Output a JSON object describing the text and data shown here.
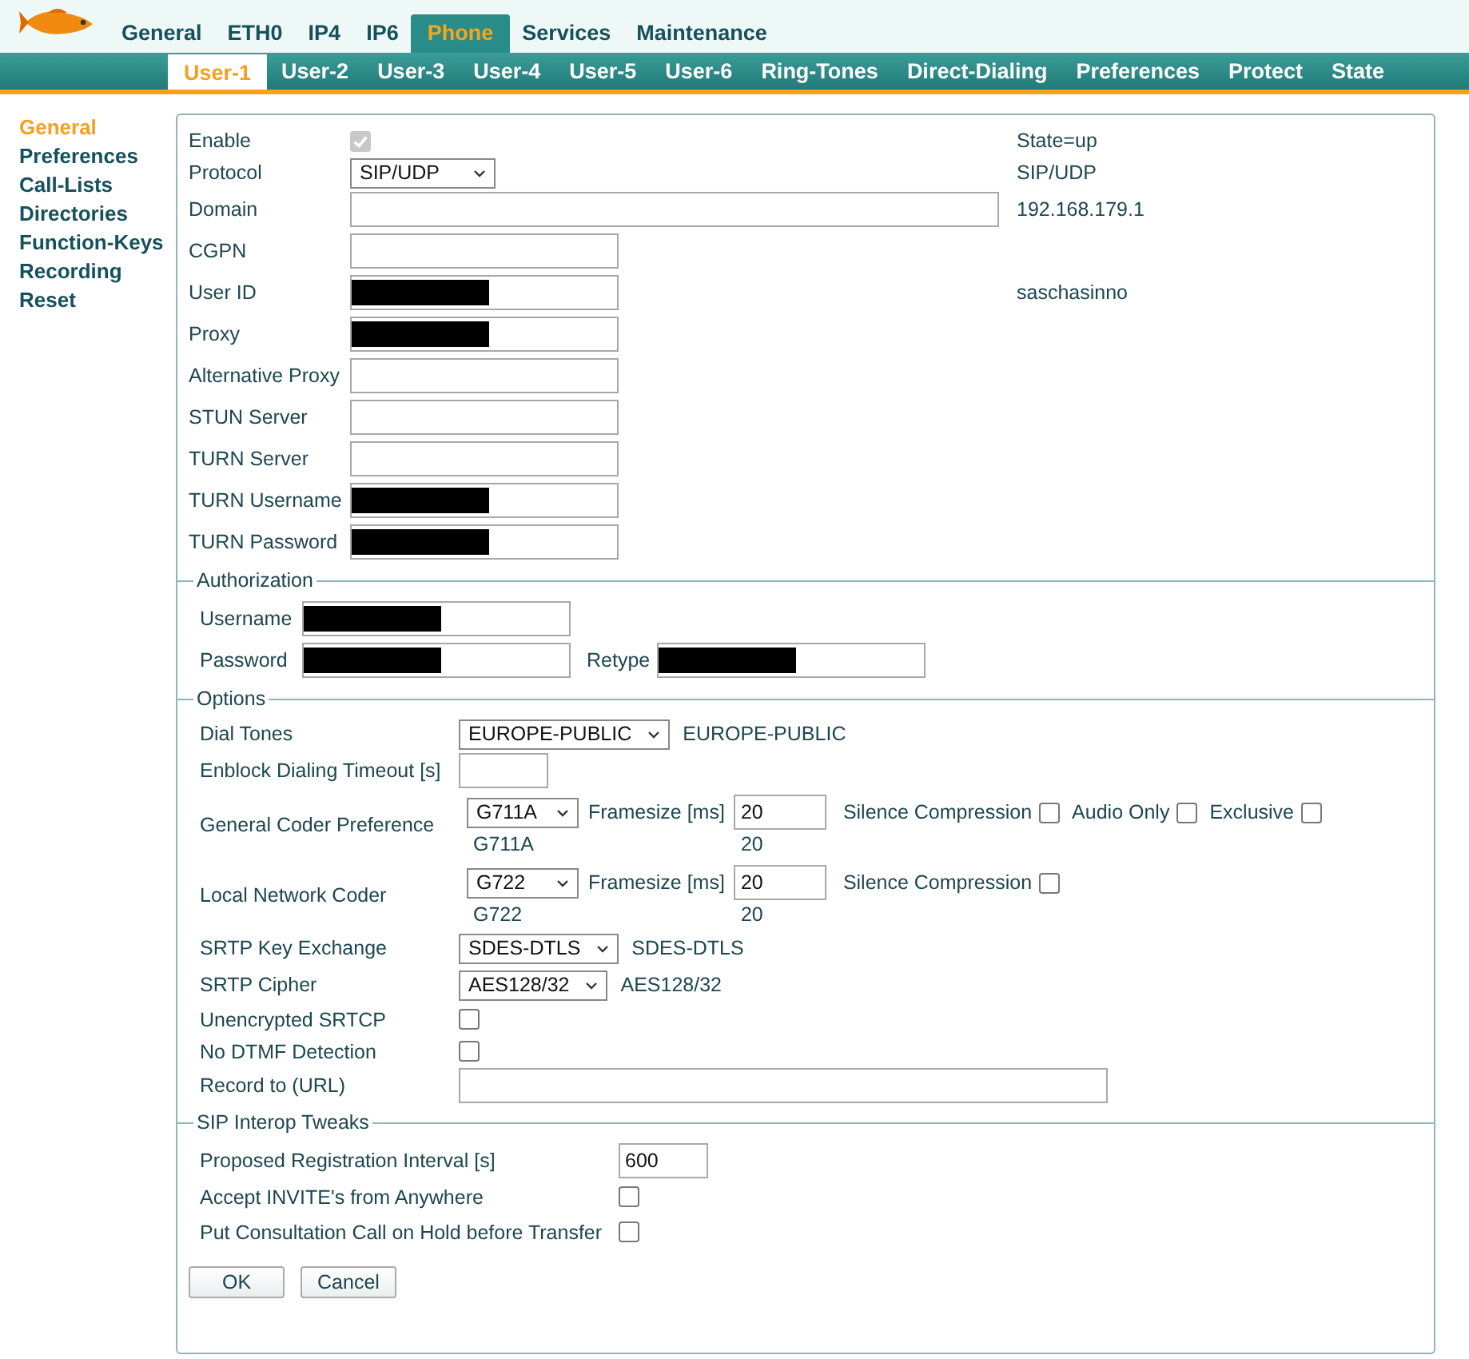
{
  "main_tabs": [
    {
      "label": "General",
      "selected": false
    },
    {
      "label": "ETH0",
      "selected": false
    },
    {
      "label": "IP4",
      "selected": false
    },
    {
      "label": "IP6",
      "selected": false
    },
    {
      "label": "Phone",
      "selected": true
    },
    {
      "label": "Services",
      "selected": false
    },
    {
      "label": "Maintenance",
      "selected": false
    }
  ],
  "sub_tabs": [
    {
      "label": "User-1",
      "selected": true
    },
    {
      "label": "User-2",
      "selected": false
    },
    {
      "label": "User-3",
      "selected": false
    },
    {
      "label": "User-4",
      "selected": false
    },
    {
      "label": "User-5",
      "selected": false
    },
    {
      "label": "User-6",
      "selected": false
    },
    {
      "label": "Ring-Tones",
      "selected": false
    },
    {
      "label": "Direct-Dialing",
      "selected": false
    },
    {
      "label": "Preferences",
      "selected": false
    },
    {
      "label": "Protect",
      "selected": false
    },
    {
      "label": "State",
      "selected": false
    }
  ],
  "sidebar": {
    "items": [
      {
        "label": "General",
        "selected": true
      },
      {
        "label": "Preferences",
        "selected": false
      },
      {
        "label": "Call-Lists",
        "selected": false
      },
      {
        "label": "Directories",
        "selected": false
      },
      {
        "label": "Function-Keys",
        "selected": false
      },
      {
        "label": "Recording",
        "selected": false
      },
      {
        "label": "Reset",
        "selected": false
      }
    ]
  },
  "general": [
    {
      "kind": "checkbox",
      "label": "Enable",
      "checked": true,
      "disabled": true,
      "status": "State=up"
    },
    {
      "kind": "select",
      "label": "Protocol",
      "value": "SIP/UDP",
      "status": "SIP/UDP"
    },
    {
      "kind": "long-text",
      "label": "Domain",
      "redacted": false,
      "status": "192.168.179.1"
    },
    {
      "kind": "text",
      "label": "CGPN",
      "redacted": false
    },
    {
      "kind": "text",
      "label": "User ID",
      "redacted": true,
      "status": "saschasinno"
    },
    {
      "kind": "text",
      "label": "Proxy",
      "redacted": true
    },
    {
      "kind": "text",
      "label": "Alternative Proxy",
      "redacted": false
    },
    {
      "kind": "text",
      "label": "STUN Server",
      "redacted": false
    },
    {
      "kind": "text",
      "label": "TURN Server",
      "redacted": false
    },
    {
      "kind": "text",
      "label": "TURN Username",
      "redacted": true
    },
    {
      "kind": "text",
      "label": "TURN Password",
      "redacted": true
    }
  ],
  "authorization": {
    "title": "Authorization",
    "username": {
      "label": "Username",
      "redacted": true
    },
    "password": {
      "label": "Password",
      "redacted": true
    },
    "retype": {
      "label": "Retype",
      "redacted": true
    }
  },
  "options": {
    "title": "Options",
    "rows": [
      {
        "kind": "select",
        "label": "Dial Tones",
        "value": "EUROPE-PUBLIC",
        "shown": "EUROPE-PUBLIC"
      },
      {
        "kind": "short-text",
        "label": "Enblock Dialing Timeout [s]"
      },
      {
        "kind": "coder",
        "label": "General Coder Preference",
        "value": "G711A",
        "shown": "G711A",
        "framesize_label": "Framesize [ms]",
        "framesize": "20",
        "framesize_shown": "20",
        "flags": [
          {
            "label": "Silence Compression",
            "checked": false
          },
          {
            "label": "Audio Only",
            "checked": false
          },
          {
            "label": "Exclusive",
            "checked": false
          }
        ]
      },
      {
        "kind": "coder",
        "label": "Local Network Coder",
        "value": "G722",
        "shown": "G722",
        "framesize_label": "Framesize [ms]",
        "framesize": "20",
        "framesize_shown": "20",
        "flags": [
          {
            "label": "Silence Compression",
            "checked": false
          }
        ]
      },
      {
        "kind": "select",
        "label": "SRTP Key Exchange",
        "value": "SDES-DTLS",
        "shown": "SDES-DTLS"
      },
      {
        "kind": "select",
        "label": "SRTP Cipher",
        "value": "AES128/32",
        "shown": "AES128/32"
      },
      {
        "kind": "checkbox",
        "label": "Unencrypted SRTCP",
        "checked": false
      },
      {
        "kind": "checkbox",
        "label": "No DTMF Detection",
        "checked": false
      },
      {
        "kind": "long-text",
        "label": "Record to (URL)"
      }
    ]
  },
  "interop": {
    "title": "SIP Interop Tweaks",
    "rows": [
      {
        "kind": "short-text",
        "label": "Proposed Registration Interval [s]",
        "value": "600"
      },
      {
        "kind": "checkbox",
        "label": "Accept INVITE's from Anywhere",
        "checked": false
      },
      {
        "kind": "checkbox",
        "label": "Put Consultation Call on Hold before Transfer",
        "checked": false
      }
    ]
  },
  "buttons": [
    "OK",
    "Cancel"
  ]
}
